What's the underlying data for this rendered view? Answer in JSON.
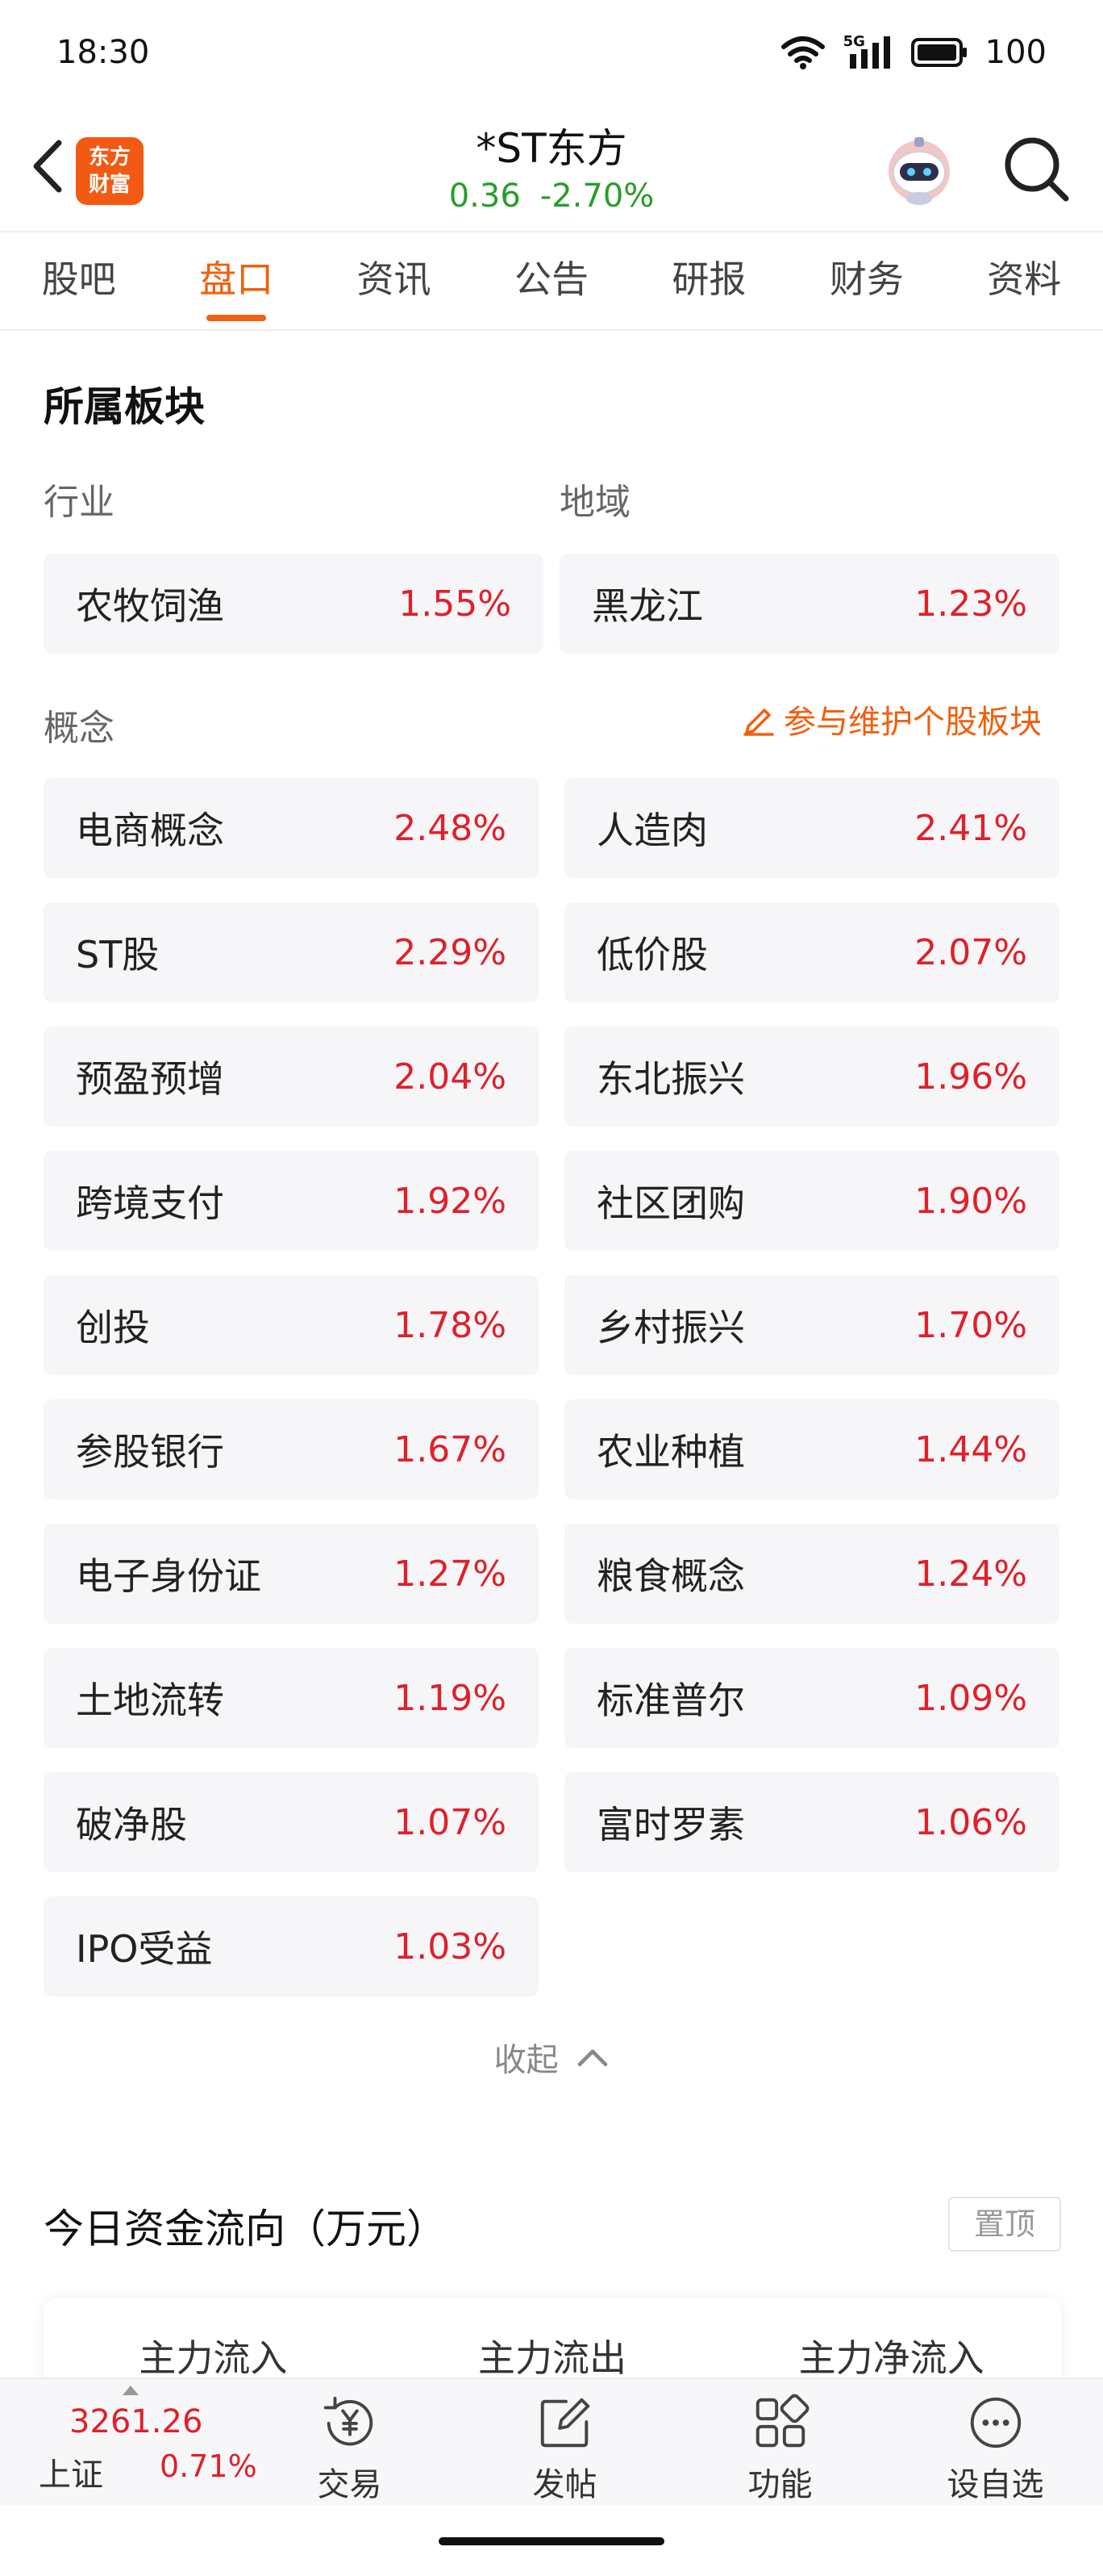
{
  "status_bar": {
    "time": "18:30",
    "network": "5G",
    "battery": "100"
  },
  "header": {
    "back_icon": "chevron-left-icon",
    "logo_line1": "东方",
    "logo_line2": "财富",
    "stock_name": "*ST东方",
    "price": "0.36",
    "change_pct": "-2.70%",
    "price_color": "#2a9d2a"
  },
  "tabs": [
    {
      "label": "股吧"
    },
    {
      "label": "盘口",
      "active": true
    },
    {
      "label": "资讯"
    },
    {
      "label": "公告"
    },
    {
      "label": "研报"
    },
    {
      "label": "财务"
    },
    {
      "label": "资料"
    }
  ],
  "sectors": {
    "title": "所属板块",
    "industry_label": "行业",
    "region_label": "地域",
    "industry": {
      "name": "农牧饲渔",
      "pct": "1.55%"
    },
    "region": {
      "name": "黑龙江",
      "pct": "1.23%"
    },
    "concept_label": "概念",
    "maintain_link": "参与维护个股板块",
    "concepts": [
      {
        "name": "电商概念",
        "pct": "2.48%"
      },
      {
        "name": "人造肉",
        "pct": "2.41%"
      },
      {
        "name": "ST股",
        "pct": "2.29%"
      },
      {
        "name": "低价股",
        "pct": "2.07%"
      },
      {
        "name": "预盈预增",
        "pct": "2.04%"
      },
      {
        "name": "东北振兴",
        "pct": "1.96%"
      },
      {
        "name": "跨境支付",
        "pct": "1.92%"
      },
      {
        "name": "社区团购",
        "pct": "1.90%"
      },
      {
        "name": "创投",
        "pct": "1.78%"
      },
      {
        "name": "乡村振兴",
        "pct": "1.70%"
      },
      {
        "name": "参股银行",
        "pct": "1.67%"
      },
      {
        "name": "农业种植",
        "pct": "1.44%"
      },
      {
        "name": "电子身份证",
        "pct": "1.27%"
      },
      {
        "name": "粮食概念",
        "pct": "1.24%"
      },
      {
        "name": "土地流转",
        "pct": "1.19%"
      },
      {
        "name": "标准普尔",
        "pct": "1.09%"
      },
      {
        "name": "破净股",
        "pct": "1.07%"
      },
      {
        "name": "富时罗素",
        "pct": "1.06%"
      },
      {
        "name": "IPO受益",
        "pct": "1.03%"
      }
    ],
    "collapse_label": "收起",
    "up_color": "#e0202a"
  },
  "fund_flow": {
    "title": "今日资金流向（万元）",
    "pin_label": "置顶",
    "columns": [
      "主力流入",
      "主力流出",
      "主力净流入"
    ]
  },
  "bottom_bar": {
    "index_value": "3261.26",
    "index_name": "上证",
    "index_pct": "0.71%",
    "items": [
      {
        "label": "交易",
        "icon": "yuan-cycle-icon"
      },
      {
        "label": "发帖",
        "icon": "edit-icon"
      },
      {
        "label": "功能",
        "icon": "grid-icon"
      },
      {
        "label": "设自选",
        "icon": "more-icon"
      }
    ]
  },
  "accent_color": "#f0600f"
}
